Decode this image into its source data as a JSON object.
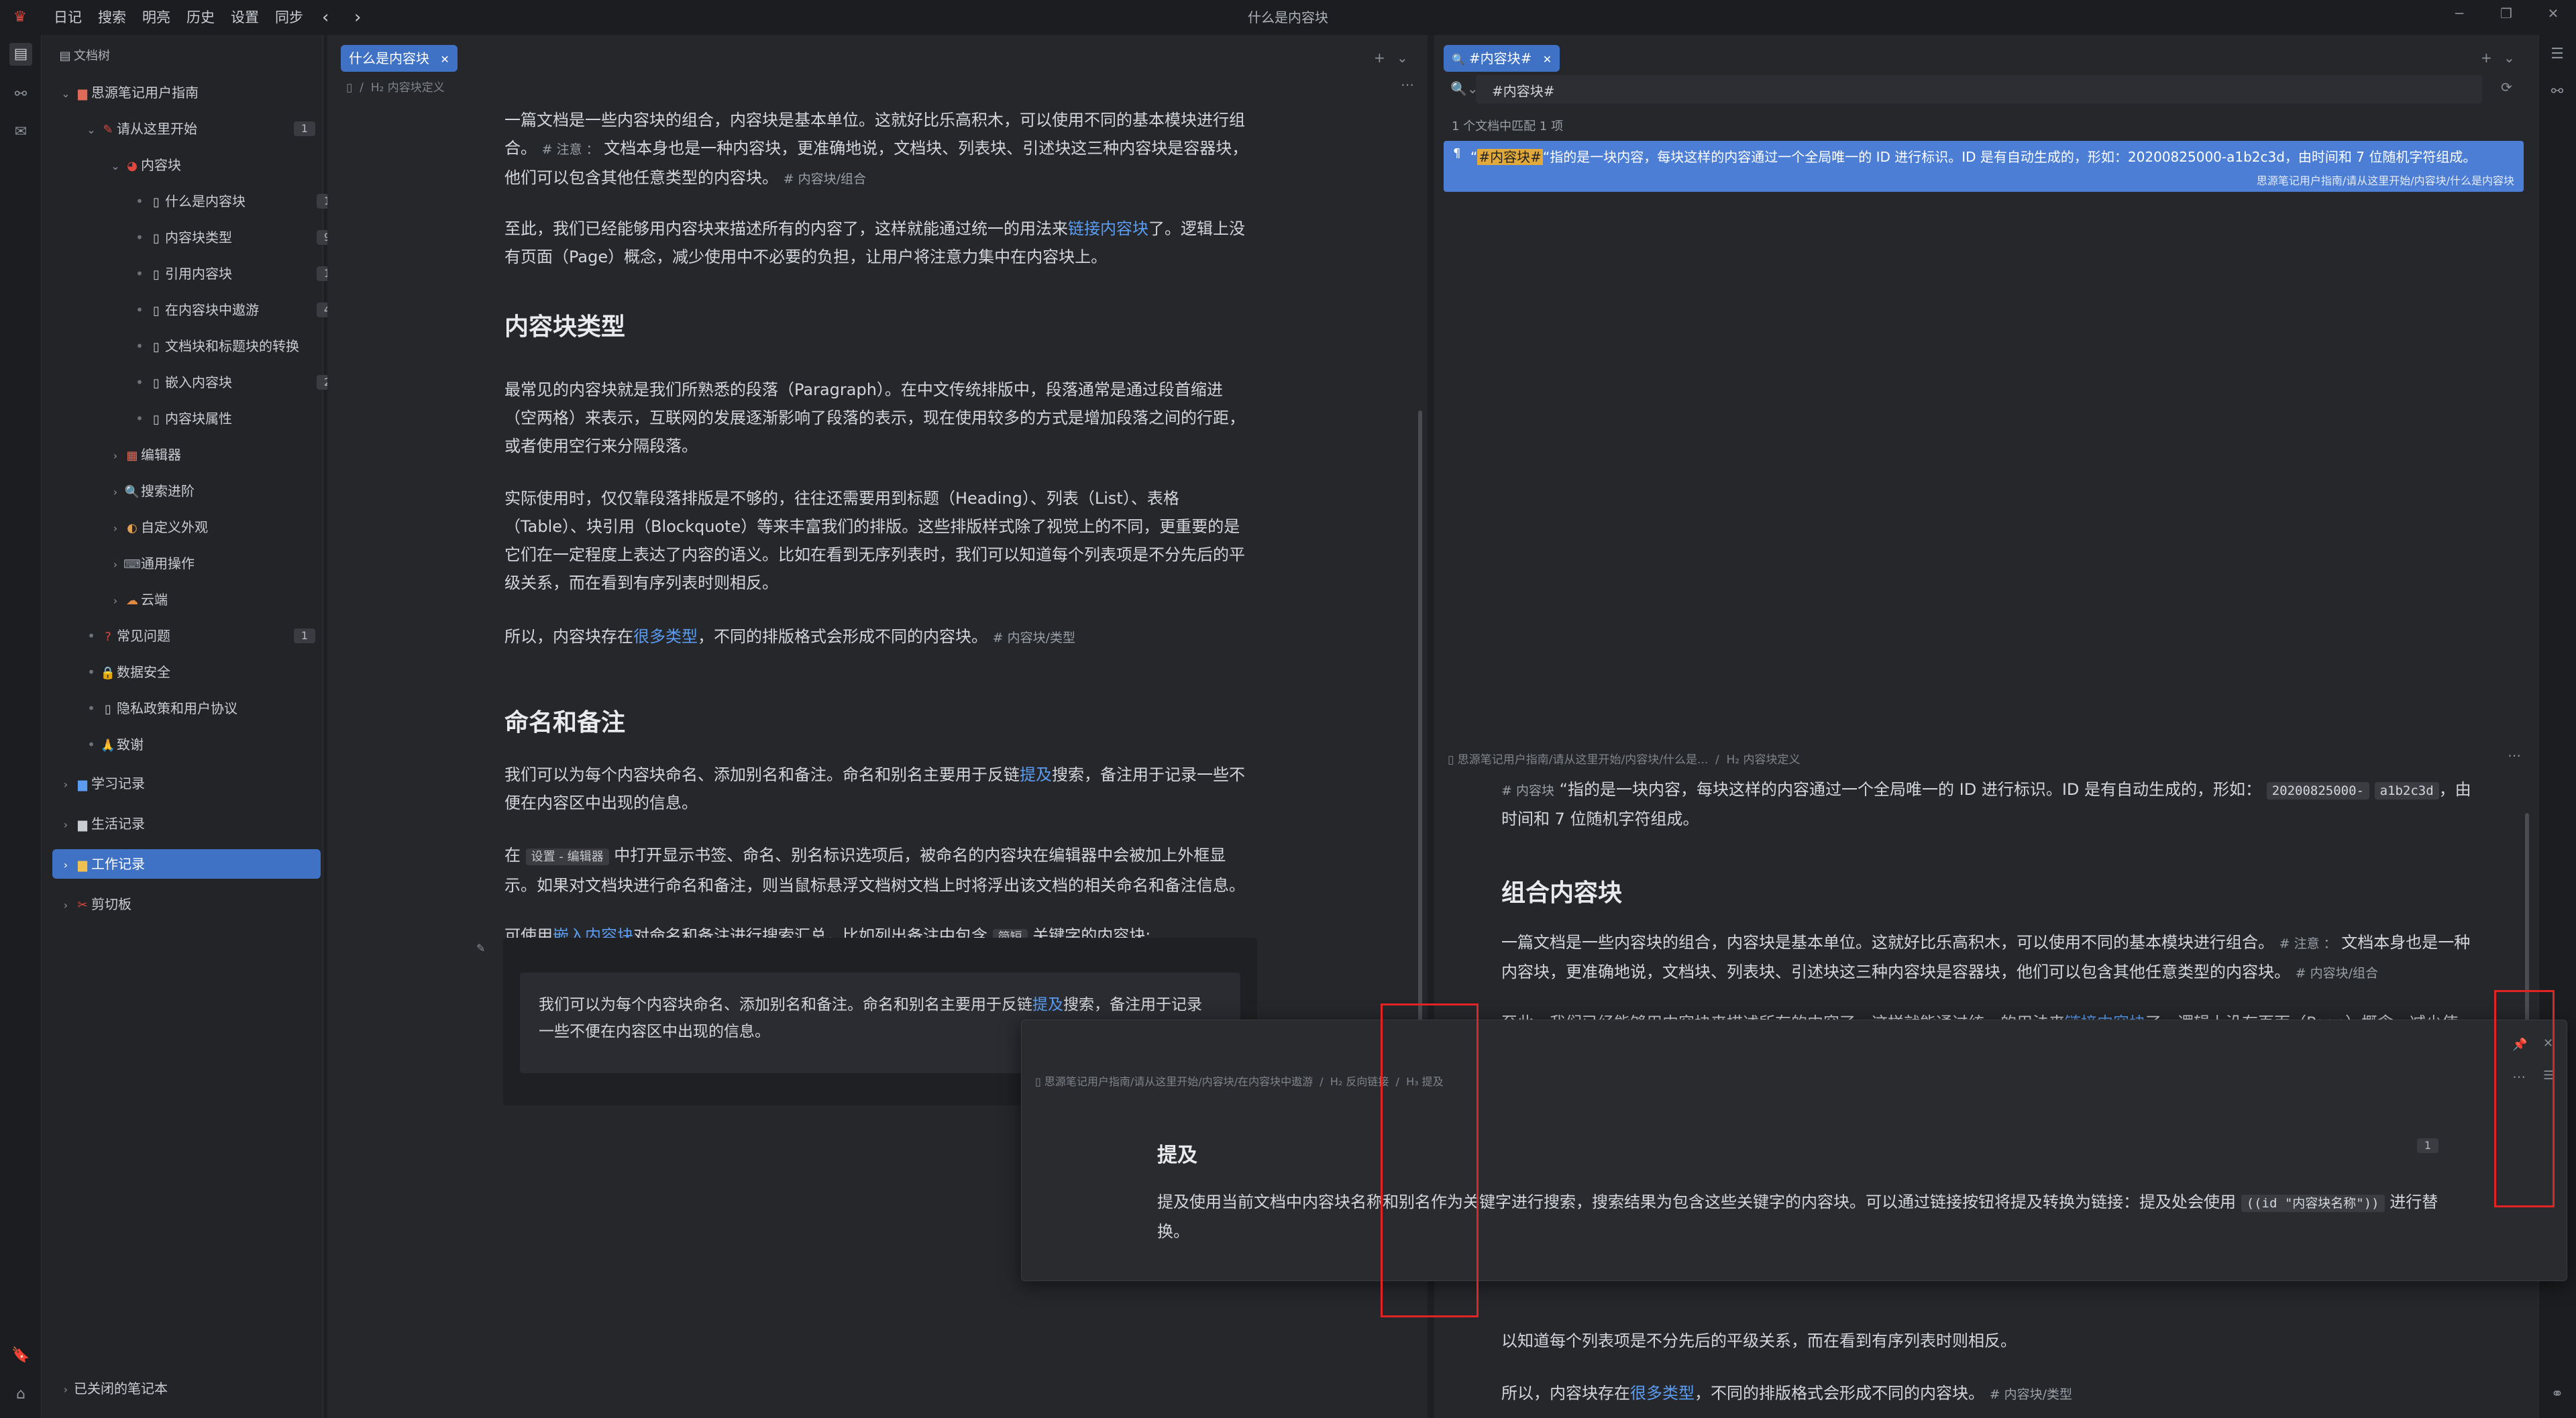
{
  "app": {
    "title": "什么是内容块",
    "menu": [
      "日记",
      "搜索",
      "明亮",
      "历史",
      "设置",
      "同步"
    ],
    "colors": {
      "accent": "#3f71c5",
      "link": "#5b9cf0",
      "highlight": "#4c7ed6",
      "annotation": "#e02424"
    }
  },
  "filetree": {
    "header": "文档树",
    "items": [
      {
        "label": "思源笔记用户指南",
        "icon": "notebook-icon"
      },
      {
        "label": "请从这里开始",
        "icon": "start-icon",
        "count": "1"
      },
      {
        "label": "内容块",
        "icon": "block-icon"
      },
      {
        "label": "什么是内容块",
        "icon": "doc-icon",
        "count": "1"
      },
      {
        "label": "内容块类型",
        "icon": "doc-icon",
        "count": "9"
      },
      {
        "label": "引用内容块",
        "icon": "doc-icon",
        "count": "1"
      },
      {
        "label": "在内容块中遨游",
        "icon": "doc-icon",
        "count": "4"
      },
      {
        "label": "文档块和标题块的转换",
        "icon": "doc-icon"
      },
      {
        "label": "嵌入内容块",
        "icon": "doc-icon",
        "count": "2"
      },
      {
        "label": "内容块属性",
        "icon": "doc-icon"
      },
      {
        "label": "编辑器",
        "icon": "editor-icon"
      },
      {
        "label": "搜索进阶",
        "icon": "search-icon"
      },
      {
        "label": "自定义外观",
        "icon": "palette-icon"
      },
      {
        "label": "通用操作",
        "icon": "keyboard-icon"
      },
      {
        "label": "云端",
        "icon": "cloud-icon"
      },
      {
        "label": "常见问题",
        "icon": "question-icon",
        "count": "1"
      },
      {
        "label": "数据安全",
        "icon": "lock-icon"
      },
      {
        "label": "隐私政策和用户协议",
        "icon": "doc-icon"
      },
      {
        "label": "致谢",
        "icon": "thanks-icon"
      },
      {
        "label": "学习记录",
        "icon": "notebook-icon"
      },
      {
        "label": "生活记录",
        "icon": "notebook-icon"
      },
      {
        "label": "工作记录",
        "icon": "notebook-icon"
      },
      {
        "label": "剪切板",
        "icon": "clipboard-icon"
      }
    ],
    "footer": "已关闭的笔记本"
  },
  "editor1": {
    "tab": "什么是内容块",
    "breadcrumb": "内容块定义",
    "p1": "一篇文档是一些内容块的组合，内容块是基本单位。这就好比乐高积木，可以使用不同的基本模块进行组合。",
    "p1_tag": "# 注意 ：",
    "p1b": "文档本身也是一种内容块，更准确地说，文档块、列表块、引述块这三种内容块是容器块，他们可以包含其他任意类型的内容块。",
    "p1_tag2": "# 内容块/组合",
    "p2a": "至此，我们已经能够用内容块来描述所有的内容了，这样就能通过统一的用法来",
    "p2_link": "链接内容块",
    "p2b": "了。逻辑上没有页面（Page）概念，减少使用中不必要的负担，让用户将注意力集中在内容块上。",
    "h_types": "内容块类型",
    "p3": "最常见的内容块就是我们所熟悉的段落（Paragraph）。在中文传统排版中，段落通常是通过段首缩进（空两格）来表示，互联网的发展逐渐影响了段落的表示，现在使用较多的方式是增加段落之间的行距，或者使用空行来分隔段落。",
    "p4": "实际使用时，仅仅靠段落排版是不够的，往往还需要用到标题（Heading）、列表（List）、表格（Table）、块引用（Blockquote）等来丰富我们的排版。这些排版样式除了视觉上的不同，更重要的是它们在一定程度上表达了内容的语义。比如在看到无序列表时，我们可以知道每个列表项是不分先后的平级关系，而在看到有序列表时则相反。",
    "p5a": "所以，内容块存在",
    "p5_link": "很多类型",
    "p5b": "，不同的排版格式会形成不同的内容块。",
    "p5_tag": "# 内容块/类型",
    "h_name": "命名和备注",
    "p6a": "我们可以为每个内容块命名、添加别名和备注。命名和别名主要用于反链",
    "p6_link": "提及",
    "p6b": "搜索，备注用于记录一些不便在内容区中出现的信息。",
    "p7a": "在",
    "p7_chip1": "设置 - 编辑器",
    "p7b": "中打开显示书签、命名、别名标识选项后，被命名的内容块在编辑器中会被加上外框显示。如果对文档块进行命名和备注，则当鼠标悬浮文档树文档上时将浮出该文档的相关命名和备注信息。",
    "p8a": "可使用",
    "p8_link": "嵌入内容块",
    "p8b": "对命名和备注进行搜索汇总，比如列出备注中包含",
    "p8_chip": "简短",
    "p8c": "关键字的内容块:",
    "embed_a": "我们可以为每个内容块命名、添加别名和备注。命名和别名主要用于反链",
    "embed_link": "提及",
    "embed_b": "搜索，备注用于记录一些不便在内容区中出现的信息。"
  },
  "editor2": {
    "tab": "#内容块#",
    "search_value": "#内容块#",
    "match_count": "1 个文档中匹配 1 项",
    "result_mark": "#内容块#",
    "result_text": "“指的是一块内容，每块这样的内容通过一个全局唯一的 ID 进行标识。ID 是有自动生成的，形如：20200825000-a1b2c3d，由时间和 7 位随机字符组成。",
    "result_path": "思源笔记用户指南/请从这里开始/内容块/什么是内容块",
    "preview_breadcrumb": "思源笔记用户指南/请从这里开始/内容块/什么是...",
    "preview_crumb2": "内容块定义",
    "pv1_tag": "# 内容块",
    "pv1a": "“指的是一块内容，每块这样的内容通过一个全局唯一的 ID 进行标识。ID 是有自动生成的，形如：",
    "pv1_code1": "20200825000-",
    "pv1_code2": "a1b2c3d",
    "pv1b": "，由时间和 7 位随机字符组成。",
    "pv_h": "组合内容块",
    "pv2": "一篇文档是一些内容块的组合，内容块是基本单位。这就好比乐高积木，可以使用不同的基本模块进行组合。",
    "pv2_tag": "# 注意 ：",
    "pv2b": "文档本身也是一种内容块，更准确地说，文档块、列表块、引述块这三种内容块是容器块，他们可以包含其他任意类型的内容块。",
    "pv2_tag2": "# 内容块/组合",
    "pv3a": "至此，我们已经能够用内容块来描述所有的内容了，这样就能通过统一的用法来",
    "pv3_link": "链接内容块",
    "pv3b": "了。逻辑上没有页面（Page）概念，减少使",
    "pv4": "以知道每个列表项是不分先后的平级关系，而在看到有序列表时则相反。",
    "pv5a": "所以，内容块存在",
    "pv5_link": "很多类型",
    "pv5b": "，不同的排版格式会形成不同的内容块。",
    "pv5_tag": "# 内容块/类型"
  },
  "popup": {
    "breadcrumb": "思源笔记用户指南/请从这里开始/内容块/在内容块中遨游",
    "crumb2": "反向链接",
    "crumb3": "提及",
    "title": "提及",
    "count": "1",
    "text_a": "提及使用当前文档中内容块名称和别名作为关键字进行搜索，搜索结果为包含这些关键字的内容块。可以通过链接按钮将提及转换为链接：提及处会使用",
    "code": "((id \"内容块名称\"))",
    "text_b": "进行替换。"
  }
}
